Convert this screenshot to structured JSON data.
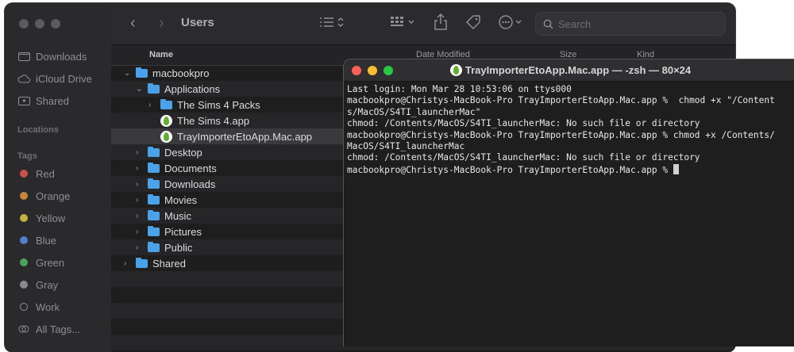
{
  "finder": {
    "title": "Users",
    "search_placeholder": "Search",
    "sidebar": {
      "favorites": [
        {
          "label": "Downloads",
          "icon": "folder-download-icon"
        },
        {
          "label": "iCloud Drive",
          "icon": "cloud-icon"
        },
        {
          "label": "Shared",
          "icon": "shared-folder-icon"
        }
      ],
      "locations_header": "Locations",
      "tags_header": "Tags",
      "tags": [
        {
          "label": "Red",
          "color": "#c9504b"
        },
        {
          "label": "Orange",
          "color": "#c7843b"
        },
        {
          "label": "Yellow",
          "color": "#c4b23e"
        },
        {
          "label": "Blue",
          "color": "#4f7fcf"
        },
        {
          "label": "Green",
          "color": "#4aa356"
        },
        {
          "label": "Gray",
          "color": "#8a8a8e"
        },
        {
          "label": "Work",
          "color": ""
        },
        {
          "label": "All Tags...",
          "color": ""
        }
      ]
    },
    "columns": {
      "name": "Name",
      "date": "Date Modified",
      "size": "Size",
      "kind": "Kind"
    },
    "rows": [
      {
        "label": "macbookpro",
        "level": 0,
        "chevron": "down",
        "icon": "home-folder"
      },
      {
        "label": "Applications",
        "level": 1,
        "chevron": "down",
        "icon": "folder"
      },
      {
        "label": "The Sims 4 Packs",
        "level": 2,
        "chevron": "right",
        "icon": "folder"
      },
      {
        "label": "The Sims 4.app",
        "level": 2,
        "chevron": "",
        "icon": "app"
      },
      {
        "label": "TrayImporterEtoApp.Mac.app",
        "level": 2,
        "chevron": "",
        "icon": "app",
        "selected": true
      },
      {
        "label": "Desktop",
        "level": 1,
        "chevron": "right",
        "icon": "folder"
      },
      {
        "label": "Documents",
        "level": 1,
        "chevron": "right",
        "icon": "folder"
      },
      {
        "label": "Downloads",
        "level": 1,
        "chevron": "right",
        "icon": "folder"
      },
      {
        "label": "Movies",
        "level": 1,
        "chevron": "right",
        "icon": "folder"
      },
      {
        "label": "Music",
        "level": 1,
        "chevron": "right",
        "icon": "folder"
      },
      {
        "label": "Pictures",
        "level": 1,
        "chevron": "right",
        "icon": "folder"
      },
      {
        "label": "Public",
        "level": 1,
        "chevron": "right",
        "icon": "folder"
      },
      {
        "label": "Shared",
        "level": 0,
        "chevron": "right",
        "icon": "folder"
      }
    ]
  },
  "terminal": {
    "title": "TrayImporterEtoApp.Mac.app — -zsh — 80×24",
    "lines": [
      "Last login: Mon Mar 28 10:53:06 on ttys000",
      "macbookpro@Christys-MacBook-Pro TrayImporterEtoApp.Mac.app %  chmod +x \"/Content",
      "s/MacOS/S4TI_launcherMac\"",
      "chmod: /Contents/MacOS/S4TI_launcherMac: No such file or directory",
      "macbookpro@Christys-MacBook-Pro TrayImporterEtoApp.Mac.app % chmod +x /Contents/",
      "MacOS/S4TI_launcherMac",
      "chmod: /Contents/MacOS/S4TI_launcherMac: No such file or directory",
      "macbookpro@Christys-MacBook-Pro TrayImporterEtoApp.Mac.app % "
    ]
  }
}
